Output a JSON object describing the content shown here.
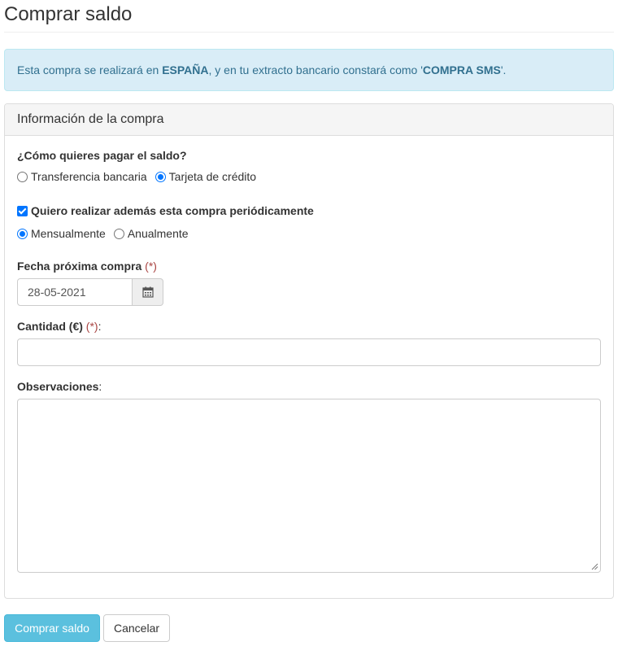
{
  "page": {
    "title": "Comprar saldo"
  },
  "alert": {
    "prefix": "Esta compra se realizará en ",
    "country": "ESPAÑA",
    "middle": ", y en tu extracto bancario constará como '",
    "concept": "COMPRA SMS",
    "suffix": "'."
  },
  "panel": {
    "heading": "Información de la compra"
  },
  "payment": {
    "label": "¿Cómo quieres pagar el saldo?",
    "options": [
      {
        "label": "Transferencia bancaria",
        "selected": false
      },
      {
        "label": "Tarjeta de crédito",
        "selected": true
      }
    ]
  },
  "periodic": {
    "label": "Quiero realizar además esta compra periódicamente",
    "checked": true,
    "options": [
      {
        "label": "Mensualmente",
        "selected": true
      },
      {
        "label": "Anualmente",
        "selected": false
      }
    ]
  },
  "date": {
    "label": "Fecha próxima compra",
    "required_mark": "(*)",
    "value": "28-05-2021",
    "icon": "calendar-icon"
  },
  "amount": {
    "label": "Cantidad (€)",
    "required_mark": "(*)",
    "colon": ":",
    "value": ""
  },
  "notes": {
    "label": "Observaciones",
    "colon": ":",
    "value": ""
  },
  "actions": {
    "submit_label": "Comprar saldo",
    "cancel_label": "Cancelar"
  },
  "colors": {
    "accent": "#0075ff",
    "alert_bg": "#d9edf7",
    "alert_text": "#31708f",
    "primary_button": "#5bc0de",
    "required": "#a94442"
  }
}
